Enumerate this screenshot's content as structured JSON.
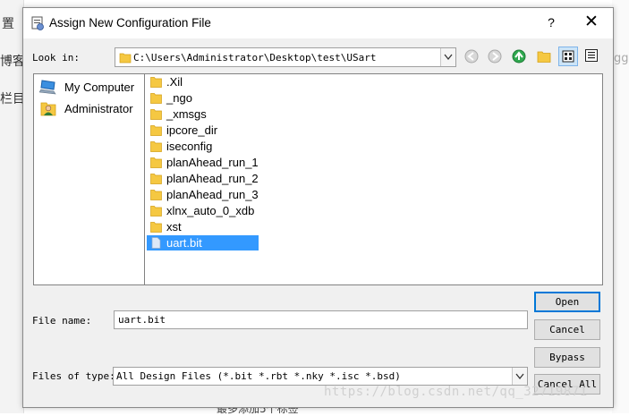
{
  "background": {
    "left_fragments": [
      "置",
      "博客",
      "栏目"
    ],
    "bottom_text": "最多添加5个标签",
    "right_text": "gg",
    "watermark": "https://blog.csdn.net/qq_32719871"
  },
  "dialog": {
    "title": "Assign New Configuration File",
    "help_label": "?",
    "close_label": "✕"
  },
  "look_in": {
    "label": "Look in:",
    "path": "C:\\Users\\Administrator\\Desktop\\test\\USart"
  },
  "toolbar": {
    "icons": [
      "back-icon",
      "forward-icon",
      "up-folder-icon",
      "new-folder-icon",
      "list-view-icon",
      "detail-view-icon"
    ]
  },
  "places": [
    {
      "label": "My Computer",
      "icon": "computer-icon"
    },
    {
      "label": "Administrator",
      "icon": "user-folder-icon"
    }
  ],
  "files": [
    {
      "name": ".Xil",
      "type": "folder"
    },
    {
      "name": "_ngo",
      "type": "folder"
    },
    {
      "name": "_xmsgs",
      "type": "folder"
    },
    {
      "name": "ipcore_dir",
      "type": "folder"
    },
    {
      "name": "iseconfig",
      "type": "folder"
    },
    {
      "name": "planAhead_run_1",
      "type": "folder"
    },
    {
      "name": "planAhead_run_2",
      "type": "folder"
    },
    {
      "name": "planAhead_run_3",
      "type": "folder"
    },
    {
      "name": "xlnx_auto_0_xdb",
      "type": "folder"
    },
    {
      "name": "xst",
      "type": "folder"
    },
    {
      "name": "uart.bit",
      "type": "file",
      "selected": true
    }
  ],
  "file_name": {
    "label": "File name:",
    "value": "uart.bit"
  },
  "files_of_type": {
    "label": "Files of type:",
    "value": "All Design Files (*.bit *.rbt *.nky *.isc *.bsd)"
  },
  "buttons": {
    "open": "Open",
    "cancel": "Cancel",
    "bypass": "Bypass",
    "cancel_all": "Cancel All"
  },
  "colors": {
    "selection": "#3399ff",
    "folder": "#f5c842",
    "default_button_border": "#0078d7"
  }
}
